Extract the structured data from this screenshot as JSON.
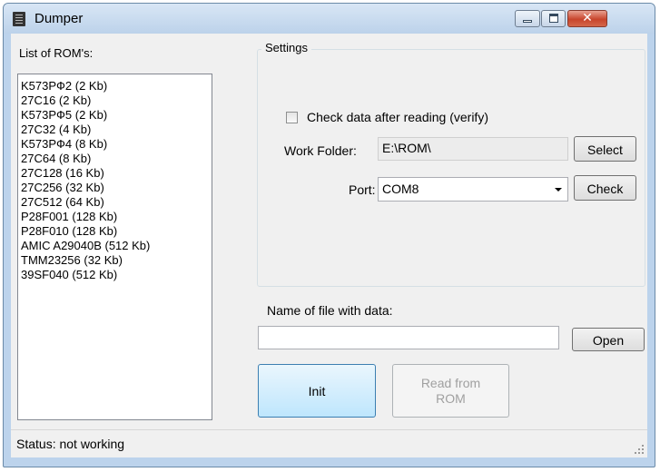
{
  "window": {
    "title": "Dumper",
    "icon": "chip-icon"
  },
  "rom_list": {
    "label": "List of ROM's:",
    "items": [
      "K573PФ2 (2 Kb)",
      "27C16 (2 Kb)",
      "K573PФ5 (2 Kb)",
      "27C32 (4 Kb)",
      "K573PФ4 (8 Kb)",
      "27C64 (8 Kb)",
      "27C128 (16 Kb)",
      "27C256 (32 Kb)",
      "27C512 (64 Kb)",
      "P28F001 (128 Kb)",
      "P28F010 (128 Kb)",
      "AMIC A29040B (512 Kb)",
      "TMM23256 (32 Kb)",
      "39SF040 (512 Kb)"
    ]
  },
  "settings": {
    "legend": "Settings",
    "verify_label": "Check data after reading (verify)",
    "verify_checked": false,
    "work_folder_label": "Work Folder:",
    "work_folder_value": "E:\\ROM\\",
    "select_button": "Select",
    "port_label": "Port:",
    "port_value": "COM8",
    "check_button": "Check"
  },
  "file": {
    "label": "Name of file with data:",
    "value": "",
    "open_button": "Open"
  },
  "actions": {
    "init_button": "Init",
    "read_button": "Read from ROM"
  },
  "status": {
    "text": "Status: not working"
  },
  "colors": {
    "window_frame": "#bcd3ec",
    "close_button": "#c8452c",
    "init_highlight": "#bee6fd"
  }
}
